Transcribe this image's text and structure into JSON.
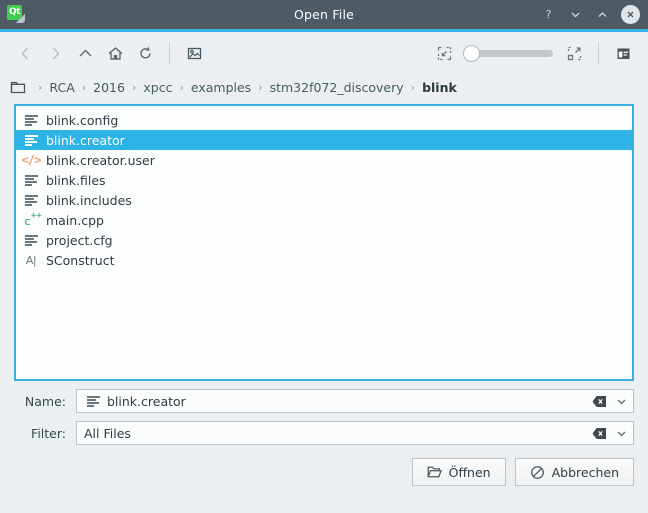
{
  "window": {
    "title": "Open File",
    "logo_label": "Qt",
    "controls": [
      {
        "name": "help",
        "glyph": "?"
      },
      {
        "name": "minimize",
        "glyph": "chevron-down"
      },
      {
        "name": "maximize",
        "glyph": "chevron-up"
      },
      {
        "name": "close",
        "glyph": "cross"
      }
    ]
  },
  "toolbar": {
    "left_buttons": [
      {
        "name": "back",
        "icon": "chevron-left-icon",
        "disabled": true
      },
      {
        "name": "forward",
        "icon": "chevron-right-icon",
        "disabled": true
      },
      {
        "name": "parent",
        "icon": "chevron-up-icon",
        "disabled": false
      },
      {
        "name": "home",
        "icon": "home-icon",
        "disabled": false
      },
      {
        "name": "reload",
        "icon": "reload-icon",
        "disabled": false
      }
    ],
    "preview_button": {
      "name": "image-preview",
      "icon": "image-icon"
    },
    "zoom_out": {
      "name": "zoom-out",
      "icon": "zoom-out-icon"
    },
    "zoom_in": {
      "name": "zoom-in",
      "icon": "zoom-in-icon"
    },
    "zoom_slider_value": 0,
    "view_mode": {
      "name": "detail-view",
      "icon": "detail-view-icon"
    }
  },
  "breadcrumb": {
    "icon": "folder-icon",
    "separator": "›",
    "items": [
      {
        "label": "RCA",
        "current": false
      },
      {
        "label": "2016",
        "current": false
      },
      {
        "label": "xpcc",
        "current": false
      },
      {
        "label": "examples",
        "current": false
      },
      {
        "label": "stm32f072_discovery",
        "current": false
      },
      {
        "label": "blink",
        "current": true
      }
    ]
  },
  "file_list": {
    "items": [
      {
        "name": "blink.config",
        "icon": "text-file-icon",
        "selected": false
      },
      {
        "name": "blink.creator",
        "icon": "text-file-icon",
        "selected": true
      },
      {
        "name": "blink.creator.user",
        "icon": "code-file-icon",
        "selected": false
      },
      {
        "name": "blink.files",
        "icon": "text-file-icon",
        "selected": false
      },
      {
        "name": "blink.includes",
        "icon": "text-file-icon",
        "selected": false
      },
      {
        "name": "main.cpp",
        "icon": "cpp-file-icon",
        "selected": false
      },
      {
        "name": "project.cfg",
        "icon": "text-file-icon",
        "selected": false
      },
      {
        "name": "SConstruct",
        "icon": "plain-text-icon",
        "selected": false
      }
    ]
  },
  "fields": {
    "name": {
      "label": "Name:",
      "value": "blink.creator",
      "icon": "text-file-icon",
      "clear_icon": "clear-icon",
      "dropdown_icon": "chevron-down-icon"
    },
    "filter": {
      "label": "Filter:",
      "value": "All Files",
      "clear_icon": "clear-icon",
      "dropdown_icon": "chevron-down-icon"
    }
  },
  "buttons": {
    "open": {
      "label": "Öffnen",
      "icon": "open-folder-icon"
    },
    "cancel": {
      "label": "Abbrechen",
      "icon": "cancel-icon"
    }
  },
  "colors": {
    "titlebar": "#4e5b65",
    "accent": "#36b0e4",
    "selection": "#2eb3e6",
    "body": "#eceff1",
    "code_icon": "#f08a4b",
    "cpp_icon": "#18a08a",
    "qt_green": "#41cd52"
  }
}
